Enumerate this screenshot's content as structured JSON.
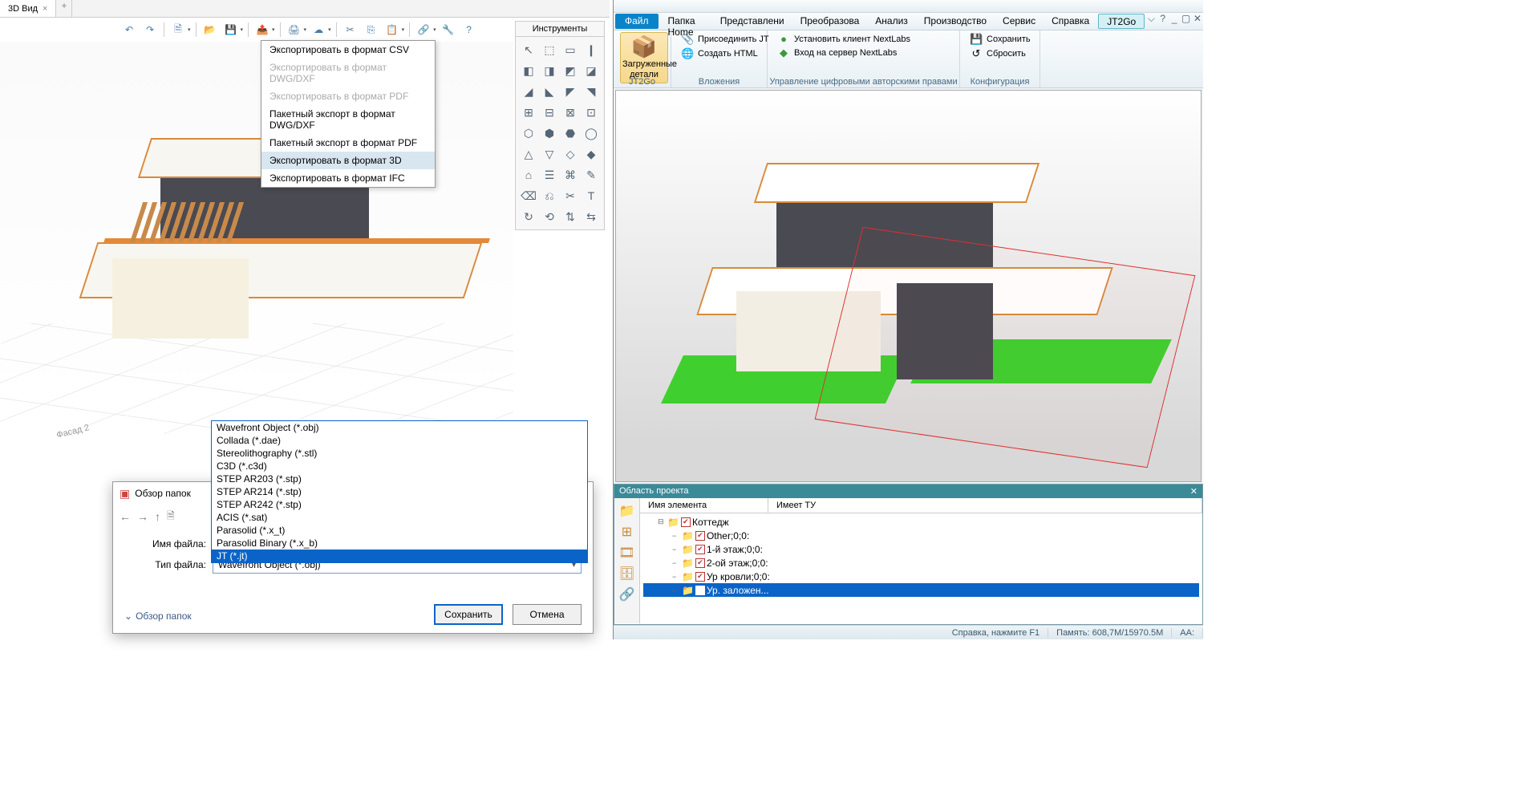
{
  "left": {
    "tab_title": "3D Вид",
    "tools_panel_title": "Инструменты",
    "export_menu": [
      {
        "label": "Экспортировать в формат CSV",
        "disabled": false
      },
      {
        "label": "Экспортировать в формат DWG/DXF",
        "disabled": true
      },
      {
        "label": "Экспортировать в формат PDF",
        "disabled": true
      },
      {
        "label": "Пакетный экспорт в формат DWG/DXF",
        "disabled": false
      },
      {
        "label": "Пакетный экспорт в формат PDF",
        "disabled": false
      },
      {
        "label": "Экспортировать в формат 3D",
        "disabled": false,
        "highlight": true
      },
      {
        "label": "Экспортировать в формат IFC",
        "disabled": false
      }
    ],
    "facade_label": "Фасад 2",
    "save_dialog": {
      "title": "Обзор папок",
      "filename_label": "Имя файла:",
      "filetype_label": "Тип файла:",
      "filename_value": "",
      "filetype_value": "Wavefront Object (*.obj)",
      "folders_link": "Обзор папок",
      "btn_save": "Сохранить",
      "btn_cancel": "Отмена"
    },
    "format_list": [
      "Wavefront Object (*.obj)",
      "Collada (*.dae)",
      "Stereolithography (*.stl)",
      "C3D (*.c3d)",
      "STEP AR203 (*.stp)",
      "STEP AR214 (*.stp)",
      "STEP AR242 (*.stp)",
      "ACIS (*.sat)",
      "Parasolid (*.x_t)",
      "Parasolid Binary (*.x_b)",
      "JT (*.jt)"
    ],
    "format_selected_index": 10
  },
  "right": {
    "menus": {
      "file": "Файл",
      "home": "Папка Home",
      "view": "Представлени",
      "transform": "Преобразова",
      "analysis": "Анализ",
      "manufacture": "Производство",
      "service": "Сервис",
      "help": "Справка",
      "jt2go": "JT2Go"
    },
    "ribbon": {
      "group_jt2go": "JT2Go",
      "btn_loaded_parts": "Загруженные детали",
      "group_attach": "Вложения",
      "btn_attach_jt": "Присоединить JT",
      "btn_create_html": "Создать HTML",
      "group_drm": "Управление цифровыми авторскими правами",
      "btn_install_next": "Установить клиент NextLabs",
      "btn_login_next": "Вход на сервер NextLabs",
      "group_config": "Конфигурация",
      "btn_save": "Сохранить",
      "btn_reset": "Сбросить"
    },
    "project": {
      "panel_title": "Область проекта",
      "col_name": "Имя элемента",
      "col_tu": "Имеет ТУ",
      "tree": [
        {
          "depth": 0,
          "label": "Коттедж",
          "expanded": true
        },
        {
          "depth": 1,
          "label": "Other;0;0:"
        },
        {
          "depth": 1,
          "label": "1-й этаж;0;0:"
        },
        {
          "depth": 1,
          "label": "2-ой этаж;0;0:"
        },
        {
          "depth": 1,
          "label": "Ур кровли;0;0:"
        },
        {
          "depth": 1,
          "label": "Ур. заложен...",
          "selected": true
        }
      ]
    },
    "status": {
      "help": "Справка, нажмите F1",
      "memory": "Память: 608,7M/15970.5M",
      "aa": "AA:"
    }
  }
}
